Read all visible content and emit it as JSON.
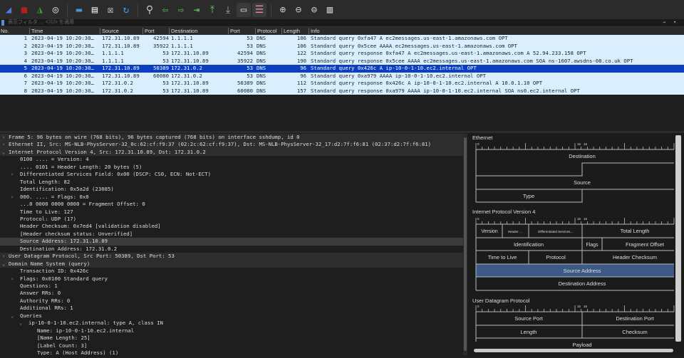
{
  "toolbar": {
    "icons": [
      "shark-fin-start-icon",
      "stop-capture-icon",
      "restart-capture-icon",
      "capture-options-icon",
      "open-file-icon",
      "save-file-icon",
      "close-file-icon",
      "reload-icon",
      "find-packet-icon",
      "go-back-icon",
      "go-forward-icon",
      "go-to-packet-icon",
      "go-first-icon",
      "go-last-icon",
      "auto-scroll-icon",
      "colorize-icon",
      "zoom-in-icon",
      "zoom-out-icon",
      "zoom-reset-icon",
      "resize-columns-icon"
    ]
  },
  "filter": {
    "placeholder": "表示フィルタ … <⌘/> を適用",
    "arrow": "→",
    "dropdown": "▾"
  },
  "packet_list": {
    "columns": [
      "No.",
      "Time",
      "Source",
      "Port",
      "Destination",
      "Port",
      "Protocol",
      "Length",
      "Info"
    ],
    "rows": [
      {
        "no": "1",
        "time": "2023-04-19 10:20:30…",
        "src": "172.31.10.89",
        "sport": "42594",
        "dst": "1.1.1.1",
        "dport": "53",
        "proto": "DNS",
        "len": "106",
        "info": "Standard query 0xfa47 A ec2messages.us-east-1.amazonaws.com OPT"
      },
      {
        "no": "2",
        "time": "2023-04-19 10:20:30…",
        "src": "172.31.10.89",
        "sport": "35922",
        "dst": "1.1.1.1",
        "dport": "53",
        "proto": "DNS",
        "len": "106",
        "info": "Standard query 0x5cee AAAA ec2messages.us-east-1.amazonaws.com OPT"
      },
      {
        "no": "3",
        "time": "2023-04-19 10:20:30…",
        "src": "1.1.1.1",
        "sport": "53",
        "dst": "172.31.10.89",
        "dport": "42594",
        "proto": "DNS",
        "len": "122",
        "info": "Standard query response 0xfa47 A ec2messages.us-east-1.amazonaws.com A 52.94.233.158 OPT"
      },
      {
        "no": "4",
        "time": "2023-04-19 10:20:30…",
        "src": "1.1.1.1",
        "sport": "53",
        "dst": "172.31.10.89",
        "dport": "35922",
        "proto": "DNS",
        "len": "190",
        "info": "Standard query response 0x5cee AAAA ec2messages.us-east-1.amazonaws.com SOA ns-1607.awsdns-08.co.uk OPT"
      },
      {
        "no": "5",
        "time": "2023-04-19 10:20:30…",
        "src": "172.31.10.89",
        "sport": "50389",
        "dst": "172.31.0.2",
        "dport": "53",
        "proto": "DNS",
        "len": "96",
        "info": "Standard query 0x426c A ip-10-0-1-10.ec2.internal OPT",
        "selected": true
      },
      {
        "no": "6",
        "time": "2023-04-19 10:20:30…",
        "src": "172.31.10.89",
        "sport": "60080",
        "dst": "172.31.0.2",
        "dport": "53",
        "proto": "DNS",
        "len": "96",
        "info": "Standard query 0xa979 AAAA ip-10-0-1-10.ec2.internal OPT"
      },
      {
        "no": "7",
        "time": "2023-04-19 10:20:30…",
        "src": "172.31.0.2",
        "sport": "53",
        "dst": "172.31.10.89",
        "dport": "50389",
        "proto": "DNS",
        "len": "112",
        "info": "Standard query response 0x426c A ip-10-0-1-10.ec2.internal A 10.0.1.10 OPT"
      },
      {
        "no": "8",
        "time": "2023-04-19 10:20:30…",
        "src": "172.31.0.2",
        "sport": "53",
        "dst": "172.31.10.89",
        "dport": "60080",
        "proto": "DNS",
        "len": "157",
        "info": "Standard query response 0xa979 AAAA ip-10-0-1-10.ec2.internal SOA ns0.ec2.internal OPT"
      }
    ],
    "colors": {
      "dns_row": "#daeefe",
      "selected": "#0b3fbf"
    }
  },
  "details": [
    {
      "t": "Frame 5: 96 bytes on wire (768 bits), 96 bytes captured (768 bits) on interface sshdump, id 0",
      "lvl": 0,
      "exp": ">",
      "top": true
    },
    {
      "t": "Ethernet II, Src: MS-NLB-PhysServer-32_0c:62:cf:f9:37 (02:2c:62:cf:f9:37), Dst: MS-NLB-PhysServer-32_17:d2:7f:f6:81 (02:37:d2:7f:f6:81)",
      "lvl": 0,
      "exp": ">",
      "top": true
    },
    {
      "t": "Internet Protocol Version 4, Src: 172.31.10.89, Dst: 172.31.0.2",
      "lvl": 0,
      "exp": "v",
      "top": true
    },
    {
      "t": "0100 .... = Version: 4",
      "lvl": 1
    },
    {
      "t": ".... 0101 = Header Length: 20 bytes (5)",
      "lvl": 1
    },
    {
      "t": "Differentiated Services Field: 0x00 (DSCP: CS0, ECN: Not-ECT)",
      "lvl": 1,
      "exp": ">"
    },
    {
      "t": "Total Length: 82",
      "lvl": 1
    },
    {
      "t": "Identification: 0x5a2d (23085)",
      "lvl": 1
    },
    {
      "t": "000. .... = Flags: 0x0",
      "lvl": 1,
      "exp": ">"
    },
    {
      "t": "...0 0000 0000 0000 = Fragment Offset: 0",
      "lvl": 1
    },
    {
      "t": "Time to Live: 127",
      "lvl": 1
    },
    {
      "t": "Protocol: UDP (17)",
      "lvl": 1
    },
    {
      "t": "Header Checksum: 0x7ed4 [validation disabled]",
      "lvl": 1
    },
    {
      "t": "[Header checksum status: Unverified]",
      "lvl": 1
    },
    {
      "t": "Source Address: 172.31.10.89",
      "lvl": 1,
      "hl": true
    },
    {
      "t": "Destination Address: 172.31.0.2",
      "lvl": 1
    },
    {
      "t": "User Datagram Protocol, Src Port: 50389, Dst Port: 53",
      "lvl": 0,
      "exp": ">",
      "top": true
    },
    {
      "t": "Domain Name System (query)",
      "lvl": 0,
      "exp": "v",
      "top": true
    },
    {
      "t": "Transaction ID: 0x426c",
      "lvl": 1
    },
    {
      "t": "Flags: 0x0100 Standard query",
      "lvl": 1,
      "exp": ">"
    },
    {
      "t": "Questions: 1",
      "lvl": 1
    },
    {
      "t": "Answer RRs: 0",
      "lvl": 1
    },
    {
      "t": "Authority RRs: 0",
      "lvl": 1
    },
    {
      "t": "Additional RRs: 1",
      "lvl": 1
    },
    {
      "t": "Queries",
      "lvl": 1,
      "exp": "v"
    },
    {
      "t": "ip-10-0-1-10.ec2.internal: type A, class IN",
      "lvl": 2,
      "exp": "v"
    },
    {
      "t": "Name: ip-10-0-1-10.ec2.internal",
      "lvl": 3
    },
    {
      "t": "[Name Length: 25]",
      "lvl": 3
    },
    {
      "t": "[Label Count: 3]",
      "lvl": 3
    },
    {
      "t": "Type: A (Host Address) (1)",
      "lvl": 3
    }
  ],
  "diagram": {
    "highlight": "#3c5a85",
    "ruler": {
      "start": "0",
      "mid_left": "15",
      "mid_right": "16"
    },
    "ethernet": {
      "title": "Ethernet",
      "destination": "Destination",
      "source": "Source",
      "type": "Type"
    },
    "ipv4": {
      "title": "Internet Protocol Version 4",
      "version": "Version",
      "header_len": "Header …",
      "dsf": "Differentiated Services…",
      "total_length": "Total Length",
      "identification": "Identification",
      "flags": "Flags",
      "fragment_offset": "Fragment Offset",
      "ttl": "Time to Live",
      "protocol": "Protocol",
      "checksum": "Header Checksum",
      "source": "Source Address",
      "destination": "Destination Address"
    },
    "udp": {
      "title": "User Datagram Protocol",
      "src_port": "Source Port",
      "dst_port": "Destination Port",
      "length": "Length",
      "checksum": "Checksum",
      "payload": "Payload"
    }
  }
}
